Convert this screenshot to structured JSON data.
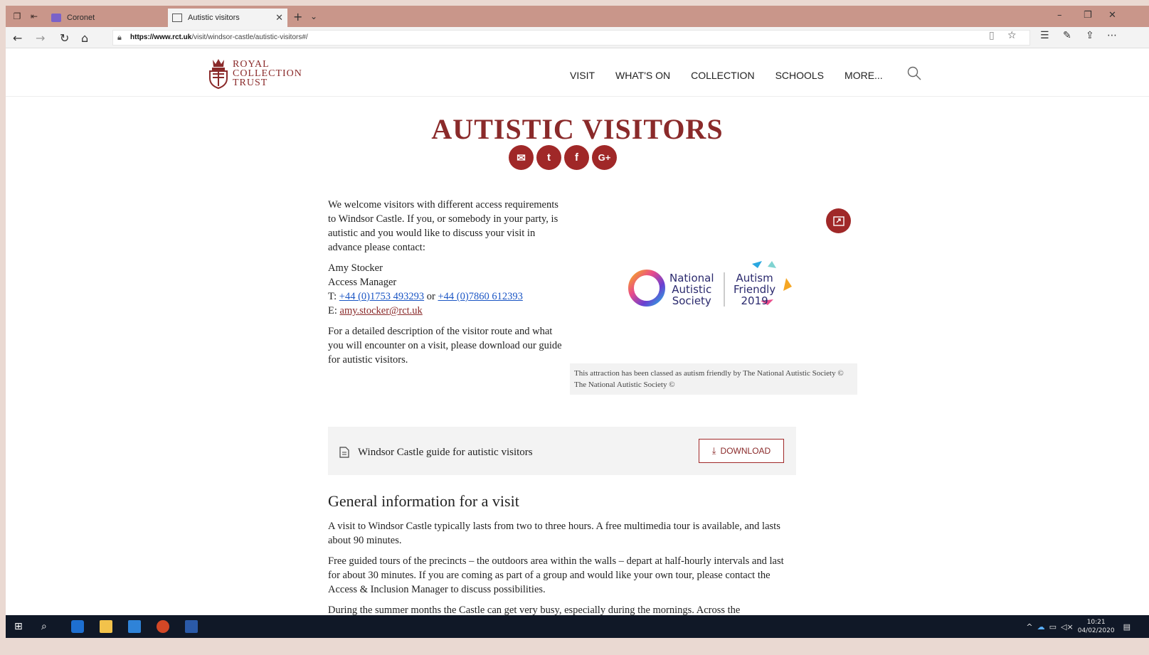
{
  "browser": {
    "tabs": [
      {
        "label": "Coronet",
        "active": false
      },
      {
        "label": "Autistic visitors",
        "active": true
      }
    ],
    "url_host": "https://www.rct.uk",
    "url_path": "/visit/windsor-castle/autistic-visitors#/",
    "icons": {
      "back": "back-arrow-icon",
      "forward": "forward-arrow-icon",
      "refresh": "refresh-icon",
      "home": "home-icon",
      "lock": "lock-icon",
      "reading": "reading-view-icon",
      "favorite": "star-icon",
      "favorites_list": "favorites-list-icon",
      "pen": "pen-icon",
      "share": "share-icon"
    }
  },
  "site": {
    "logo_lines": [
      "ROYAL",
      "COLLECTION",
      "TRUST"
    ],
    "nav": [
      "VISIT",
      "WHAT'S ON",
      "COLLECTION",
      "SCHOOLS",
      "MORE..."
    ]
  },
  "page": {
    "title": "AUTISTIC VISITORS",
    "share_icons": [
      "email-icon",
      "twitter-icon",
      "facebook-icon",
      "google-plus-icon"
    ],
    "share_glyphs": {
      "email": "✉",
      "twitter": "t",
      "facebook": "f",
      "google_plus": "G+"
    },
    "intro": "We welcome visitors with different access requirements to Windsor Castle. If you, or somebody in your party, is autistic and you would like to discuss your visit in advance please contact:",
    "contact": {
      "name": "Amy Stocker",
      "role": "Access Manager",
      "tel_prefix": "T: ",
      "phone1": "+44 (0)1753 493293",
      "or": " or ",
      "phone2": "+44 (0)7860 612393",
      "email_prefix": "E: ",
      "email": "amy.stocker@rct.uk"
    },
    "guide_text": "For a detailed description of the visitor route and what you will encounter on a visit, please download our guide for autistic visitors.",
    "nas_logo": {
      "left": [
        "National",
        "Autistic",
        "Society"
      ],
      "right": [
        "Autism",
        "Friendly",
        "2019"
      ]
    },
    "caption": "This attraction has been classed as autism friendly by The National Autistic Society © The National Autistic Society ©",
    "download": {
      "title": "Windsor Castle guide for autistic visitors",
      "button": "DOWNLOAD"
    },
    "general": {
      "heading": "General information for a visit",
      "paragraphs": [
        "A visit to Windsor Castle typically lasts from two to three hours. A free multimedia tour is available, and lasts about 90 minutes.",
        "Free guided tours of the precincts – the outdoors area within the walls – depart at half-hourly intervals and last for about 30 minutes. If you are coming as part of a group and would like your own tour, please contact the Access & Inclusion Manager to discuss possibilities.",
        "During the summer months the Castle can get very busy, especially during the mornings. Across the"
      ]
    }
  },
  "taskbar": {
    "time": "10:21",
    "date": "04/02/2020"
  },
  "colors": {
    "accent": "#8a2a2a",
    "button_red": "#a02828",
    "chrome": "#c9968a"
  }
}
